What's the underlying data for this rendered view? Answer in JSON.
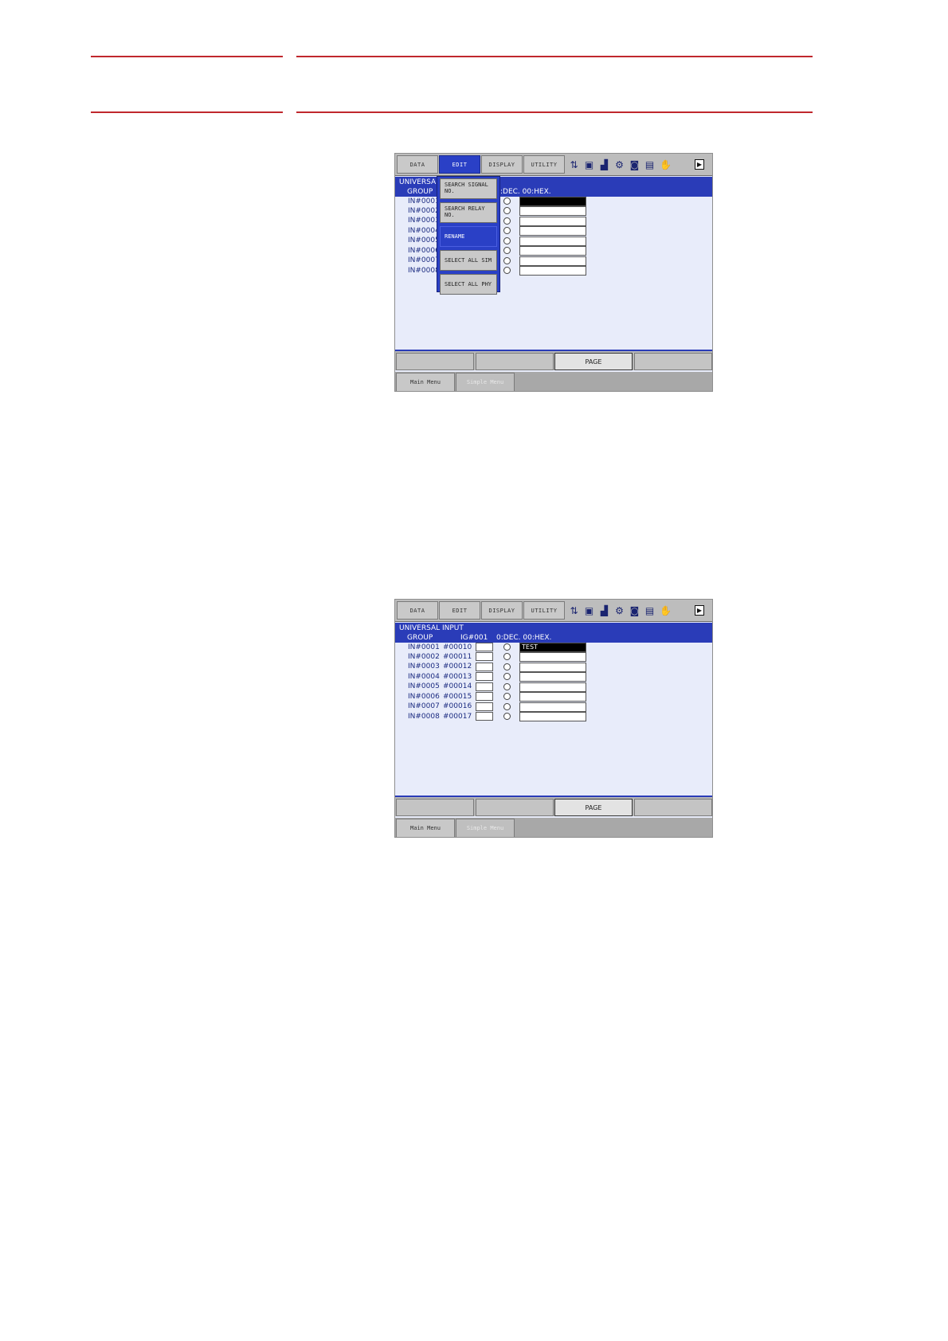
{
  "screen1": {
    "menu_tabs": [
      "DATA",
      "EDIT",
      "DISPLAY",
      "UTILITY"
    ],
    "active_tab": 1,
    "title": "UNIVERSAL",
    "group_label": "GROUP",
    "mode_text": ":DEC.  00:HEX.",
    "rows": [
      "IN#0001",
      "IN#0002",
      "IN#0003",
      "IN#0004",
      "IN#0005",
      "IN#0006",
      "IN#0007",
      "IN#0008"
    ],
    "edit_menu": [
      {
        "label": "SEARCH SIGNAL NO.",
        "active": false
      },
      {
        "label": "SEARCH RELAY NO.",
        "active": false
      },
      {
        "label": "RENAME",
        "active": true
      },
      {
        "label": "SELECT ALL SIM",
        "active": false
      },
      {
        "label": "SELECT ALL PHY",
        "active": false
      }
    ],
    "fkeys": [
      "",
      "",
      "PAGE",
      ""
    ],
    "bottom_tabs": [
      "Main Menu",
      "Simple Menu"
    ]
  },
  "screen2": {
    "menu_tabs": [
      "DATA",
      "EDIT",
      "DISPLAY",
      "UTILITY"
    ],
    "active_tab": -1,
    "title": "UNIVERSAL  INPUT",
    "group_label": "GROUP",
    "group_value": "IG#001",
    "mode_text": "0:DEC.  00:HEX.",
    "rows": [
      {
        "signal": "IN#0001",
        "relay": "#00010",
        "name": "TEST"
      },
      {
        "signal": "IN#0002",
        "relay": "#00011",
        "name": ""
      },
      {
        "signal": "IN#0003",
        "relay": "#00012",
        "name": ""
      },
      {
        "signal": "IN#0004",
        "relay": "#00013",
        "name": ""
      },
      {
        "signal": "IN#0005",
        "relay": "#00014",
        "name": ""
      },
      {
        "signal": "IN#0006",
        "relay": "#00015",
        "name": ""
      },
      {
        "signal": "IN#0007",
        "relay": "#00016",
        "name": ""
      },
      {
        "signal": "IN#0008",
        "relay": "#00017",
        "name": ""
      }
    ],
    "fkeys": [
      "",
      "",
      "PAGE",
      ""
    ],
    "bottom_tabs": [
      "Main Menu",
      "Simple Menu"
    ]
  },
  "status_icons": [
    "axis-icon",
    "tool-icon",
    "signal-icon",
    "robot-icon",
    "frame-icon",
    "memory-icon",
    "hand-icon",
    "end-icon"
  ]
}
